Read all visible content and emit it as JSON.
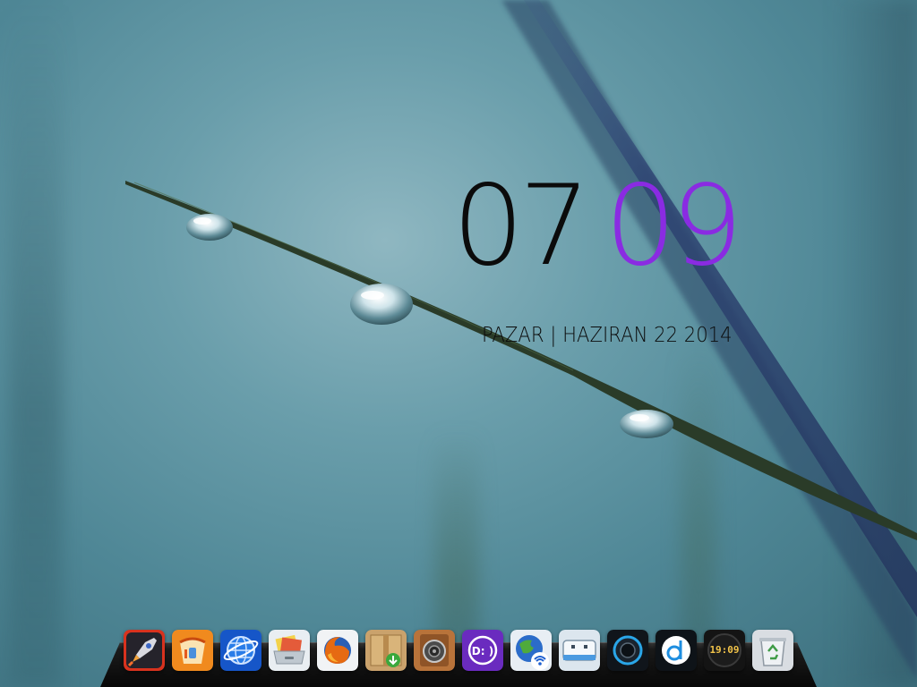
{
  "clock": {
    "hours": "07",
    "minutes": "09",
    "date_line": "PAZAR | HAZIRAN 22 2014",
    "hours_color": "#0b0b0b",
    "minutes_color": "#8a2be2"
  },
  "dock": {
    "items": [
      {
        "name": "rocket-app",
        "icon": "rocket-icon"
      },
      {
        "name": "cleanup-app",
        "icon": "cleanup-icon"
      },
      {
        "name": "web-globe-app",
        "icon": "globe-icon"
      },
      {
        "name": "folder-drive-app",
        "icon": "folder-drive-icon"
      },
      {
        "name": "firefox-app",
        "icon": "firefox-icon"
      },
      {
        "name": "download-box-app",
        "icon": "download-box-icon"
      },
      {
        "name": "speaker-app",
        "icon": "speaker-icon"
      },
      {
        "name": "disk-d-app",
        "icon": "disk-d-icon",
        "label": "D: )"
      },
      {
        "name": "network-globe-app",
        "icon": "wifi-globe-icon"
      },
      {
        "name": "drive-app",
        "icon": "drive-icon"
      },
      {
        "name": "power-app",
        "icon": "power-ring-icon"
      },
      {
        "name": "music-player-app",
        "icon": "music-d-icon"
      },
      {
        "name": "dock-clock-app",
        "icon": "digital-clock-icon",
        "time": "19:09"
      },
      {
        "name": "recycle-bin-app",
        "icon": "recycle-bin-icon"
      }
    ]
  }
}
